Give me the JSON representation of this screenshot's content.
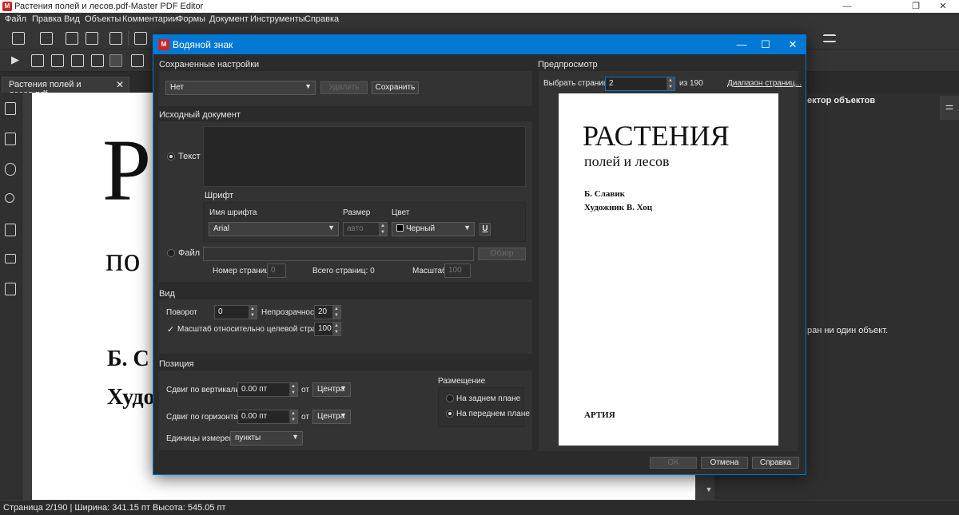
{
  "window": {
    "title": "Растения полей и лесов.pdf-Master PDF Editor",
    "app_icon": "M"
  },
  "menu": [
    "Файл",
    "Правка",
    "Вид",
    "Объекты",
    "Комментарии",
    "Формы",
    "Документ",
    "Инструменты",
    "Справка"
  ],
  "tab": {
    "label": "Растения полей и лесов.pdf",
    "close": "✕"
  },
  "document": {
    "big_letter": "Р",
    "line2": "по",
    "line3": "Б. С",
    "line4": "Худо"
  },
  "right_panel": {
    "header": "ектор объектов",
    "message": "ран ни один объект."
  },
  "status": "Страница 2/190 | Ширина: 341.15 пт Высота: 545.05 пт",
  "dialog": {
    "title": "Водяной знак",
    "saved": {
      "title": "Сохраненные настройки",
      "value": "Нет",
      "delete": "Удалить",
      "save": "Сохранить"
    },
    "source": {
      "title": "Исходный документ",
      "text_option": "Текст",
      "font_section": "Шрифт",
      "font_name_label": "Имя шрифта",
      "font_name": "Arial",
      "size_label": "Размер",
      "size": "авто",
      "color_label": "Цвет",
      "color": "Черный",
      "underline": "U",
      "file_option": "Файл",
      "browse": "Обзор",
      "page_number_label": "Номер страницы",
      "page_number": "0",
      "total_pages": "Всего страниц: 0",
      "scale_label": "Масштаб",
      "scale": "100"
    },
    "view": {
      "title": "Вид",
      "rotation_label": "Поворот",
      "rotation": "0",
      "opacity_label": "Непрозрачность",
      "opacity": "20",
      "relative_scale_check": "✓",
      "relative_scale_label": "Масштаб относительно целевой страницы",
      "relative_scale": "100"
    },
    "position": {
      "title": "Позиция",
      "vshift_label": "Сдвиг по вертикали",
      "vshift": "0.00 пт",
      "from1": "от",
      "vfrom": "Центра",
      "hshift_label": "Сдвиг по горизонтали",
      "hshift": "0.00 пт",
      "from2": "от",
      "hfrom": "Центра",
      "units_label": "Единицы измерения",
      "units": "пункты",
      "placement_title": "Размещение",
      "back": "На заднем плане",
      "front": "На переднем плане"
    },
    "preview": {
      "title": "Предпросмотр",
      "select_page_label": "Выбрать страницу",
      "page": "2",
      "of": "из",
      "total": "190",
      "range_link": "Диапазон страниц...",
      "page_title": "РАСТЕНИЯ",
      "page_subtitle": "полей и лесов",
      "author": "Б. Славик",
      "artist": "Художник В. Хоц",
      "publisher": "АРТИЯ"
    },
    "buttons": {
      "ok": "OK",
      "cancel": "Отмена",
      "help": "Справка"
    }
  }
}
